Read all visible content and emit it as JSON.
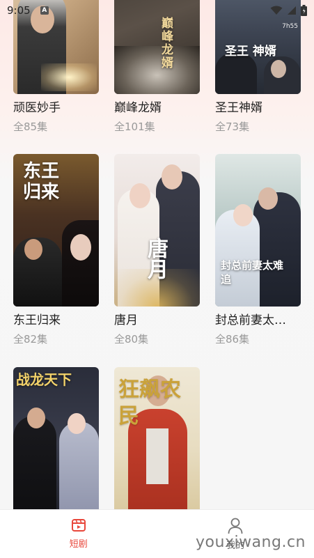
{
  "status_bar": {
    "time": "9:05",
    "notification_icon": "A"
  },
  "dramas": [
    {
      "title": "顽医妙手",
      "episodes": "全85集",
      "poster_art": "",
      "badge": ""
    },
    {
      "title": "巅峰龙婿",
      "episodes": "全101集",
      "poster_art": "巅峰龙婿",
      "badge": ""
    },
    {
      "title": "圣王神婿",
      "episodes": "全73集",
      "poster_art": "圣王 神婿",
      "badge": "7h55"
    },
    {
      "title": "东王归来",
      "episodes": "全82集",
      "poster_art": "东王归来",
      "badge": ""
    },
    {
      "title": "唐月",
      "episodes": "全80集",
      "poster_art": "唐月",
      "badge": ""
    },
    {
      "title": "封总前妻太…",
      "episodes": "全86集",
      "poster_art": "封总前妻太难追",
      "badge": ""
    },
    {
      "title": "",
      "episodes": "",
      "poster_art": "战龙天下",
      "badge": ""
    },
    {
      "title": "",
      "episodes": "",
      "poster_art": "狂飙农民",
      "badge": ""
    }
  ],
  "tabbar": {
    "tab_short_drama": "短剧",
    "tab_mine": "我的"
  },
  "watermark": "youxiwang.cn",
  "colors": {
    "accent": "#e8473b",
    "title_text": "#222222",
    "count_text": "#999999"
  }
}
